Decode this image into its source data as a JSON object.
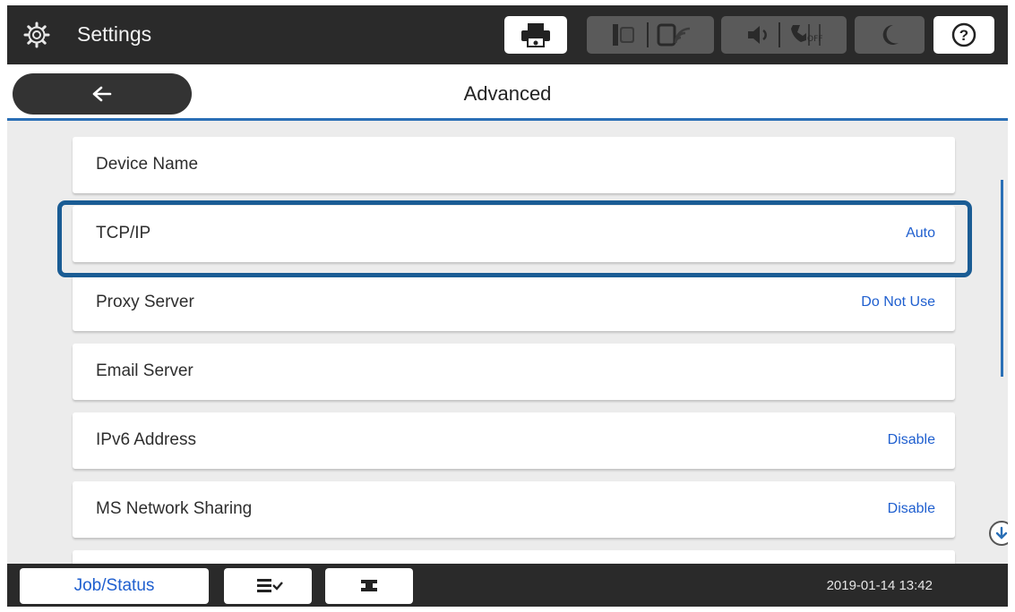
{
  "topbar": {
    "title": "Settings",
    "icons": [
      "gear-icon",
      "printer-icon",
      "ethernet-icon",
      "wifi-icon",
      "speaker-icon",
      "fax-off-icon",
      "moon-icon",
      "help-icon"
    ],
    "help_label": "?"
  },
  "header": {
    "title": "Advanced",
    "back_icon": "arrow-left-icon"
  },
  "list": {
    "items": [
      {
        "label": "Device Name",
        "value": ""
      },
      {
        "label": "TCP/IP",
        "value": "Auto",
        "highlighted": true
      },
      {
        "label": "Proxy Server",
        "value": "Do Not Use"
      },
      {
        "label": "Email Server",
        "value": ""
      },
      {
        "label": "IPv6 Address",
        "value": "Disable"
      },
      {
        "label": "MS Network Sharing",
        "value": "Disable"
      }
    ]
  },
  "bottombar": {
    "job_status_label": "Job/Status",
    "datetime": "2019-01-14 13:42"
  },
  "colors": {
    "accent": "#2a6fb6",
    "highlight": "#1a5c94",
    "value_text": "#1f5fcf",
    "bar": "#2a2a2a"
  }
}
